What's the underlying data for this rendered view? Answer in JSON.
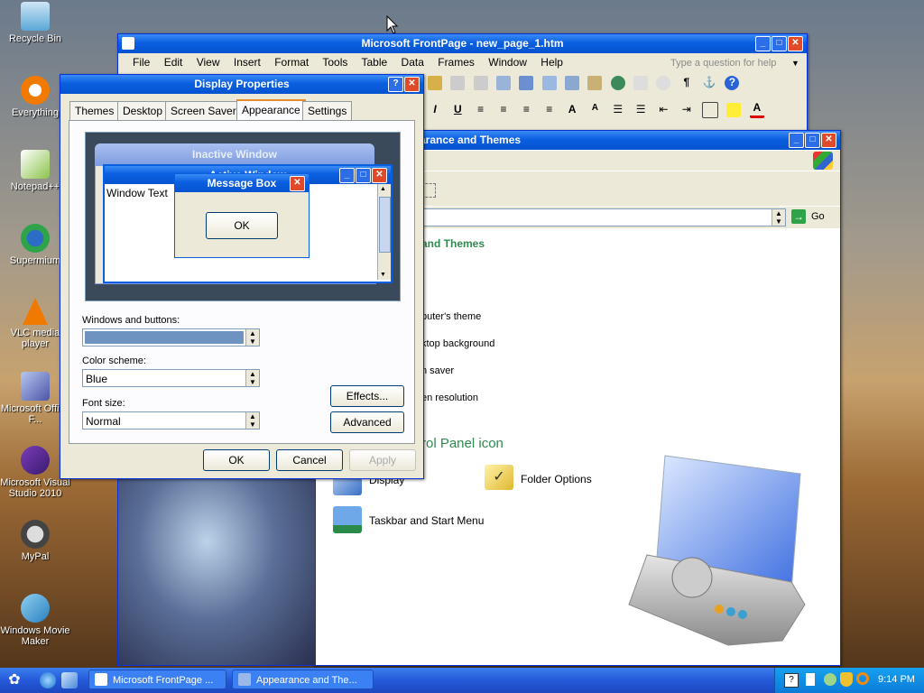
{
  "desktop": {
    "icons": [
      {
        "label": "Recycle Bin"
      },
      {
        "label": "Everything"
      },
      {
        "label": "Notepad++"
      },
      {
        "label": "Supermium"
      },
      {
        "label": "VLC media player"
      },
      {
        "label": "Microsoft Office F..."
      },
      {
        "label": "Microsoft Visual Studio 2010"
      },
      {
        "label": "MyPal"
      },
      {
        "label": "Windows Movie Maker"
      }
    ]
  },
  "frontpage": {
    "title": "Microsoft FrontPage - new_page_1.htm",
    "menu": [
      "File",
      "Edit",
      "View",
      "Insert",
      "Format",
      "Tools",
      "Table",
      "Data",
      "Frames",
      "Window",
      "Help"
    ],
    "help_placeholder": "Type a question for help"
  },
  "control_panel": {
    "title_visible": "arance and Themes",
    "address_go": "Go",
    "category_heading_visible": "and Themes",
    "tasks_visible": [
      "puter's theme",
      "ktop background",
      "n saver",
      "en resolution"
    ],
    "pick_icon_heading_visible": "rol Panel icon",
    "items": [
      {
        "label": "Display",
        "icon": "display-icon"
      },
      {
        "label": "Folder Options",
        "icon": "folder-options-icon"
      },
      {
        "label": "Taskbar and Start Menu",
        "icon": "taskbar-icon"
      }
    ]
  },
  "display_properties": {
    "title": "Display Properties",
    "tabs": [
      "Themes",
      "Desktop",
      "Screen Saver",
      "Appearance",
      "Settings"
    ],
    "active_tab": "Appearance",
    "preview": {
      "inactive_title": "Inactive Window",
      "active_title": "Active Window",
      "window_text": "Window Text",
      "msgbox_title": "Message Box",
      "msgbox_ok": "OK"
    },
    "windows_buttons_label": "Windows and buttons:",
    "windows_buttons_value": "",
    "color_scheme_label": "Color scheme:",
    "color_scheme_value": "Blue",
    "font_size_label": "Font size:",
    "font_size_value": "Normal",
    "effects_button": "Effects...",
    "advanced_button": "Advanced",
    "ok_button": "OK",
    "cancel_button": "Cancel",
    "apply_button": "Apply"
  },
  "taskbar": {
    "tasks": [
      "Microsoft FrontPage ...",
      "Appearance and The..."
    ],
    "clock": "9:14 PM"
  },
  "colors": {
    "xp_blue": "#0a5fe0",
    "close_red": "#e04a28",
    "control_panel_green": "#2e8a4e"
  }
}
